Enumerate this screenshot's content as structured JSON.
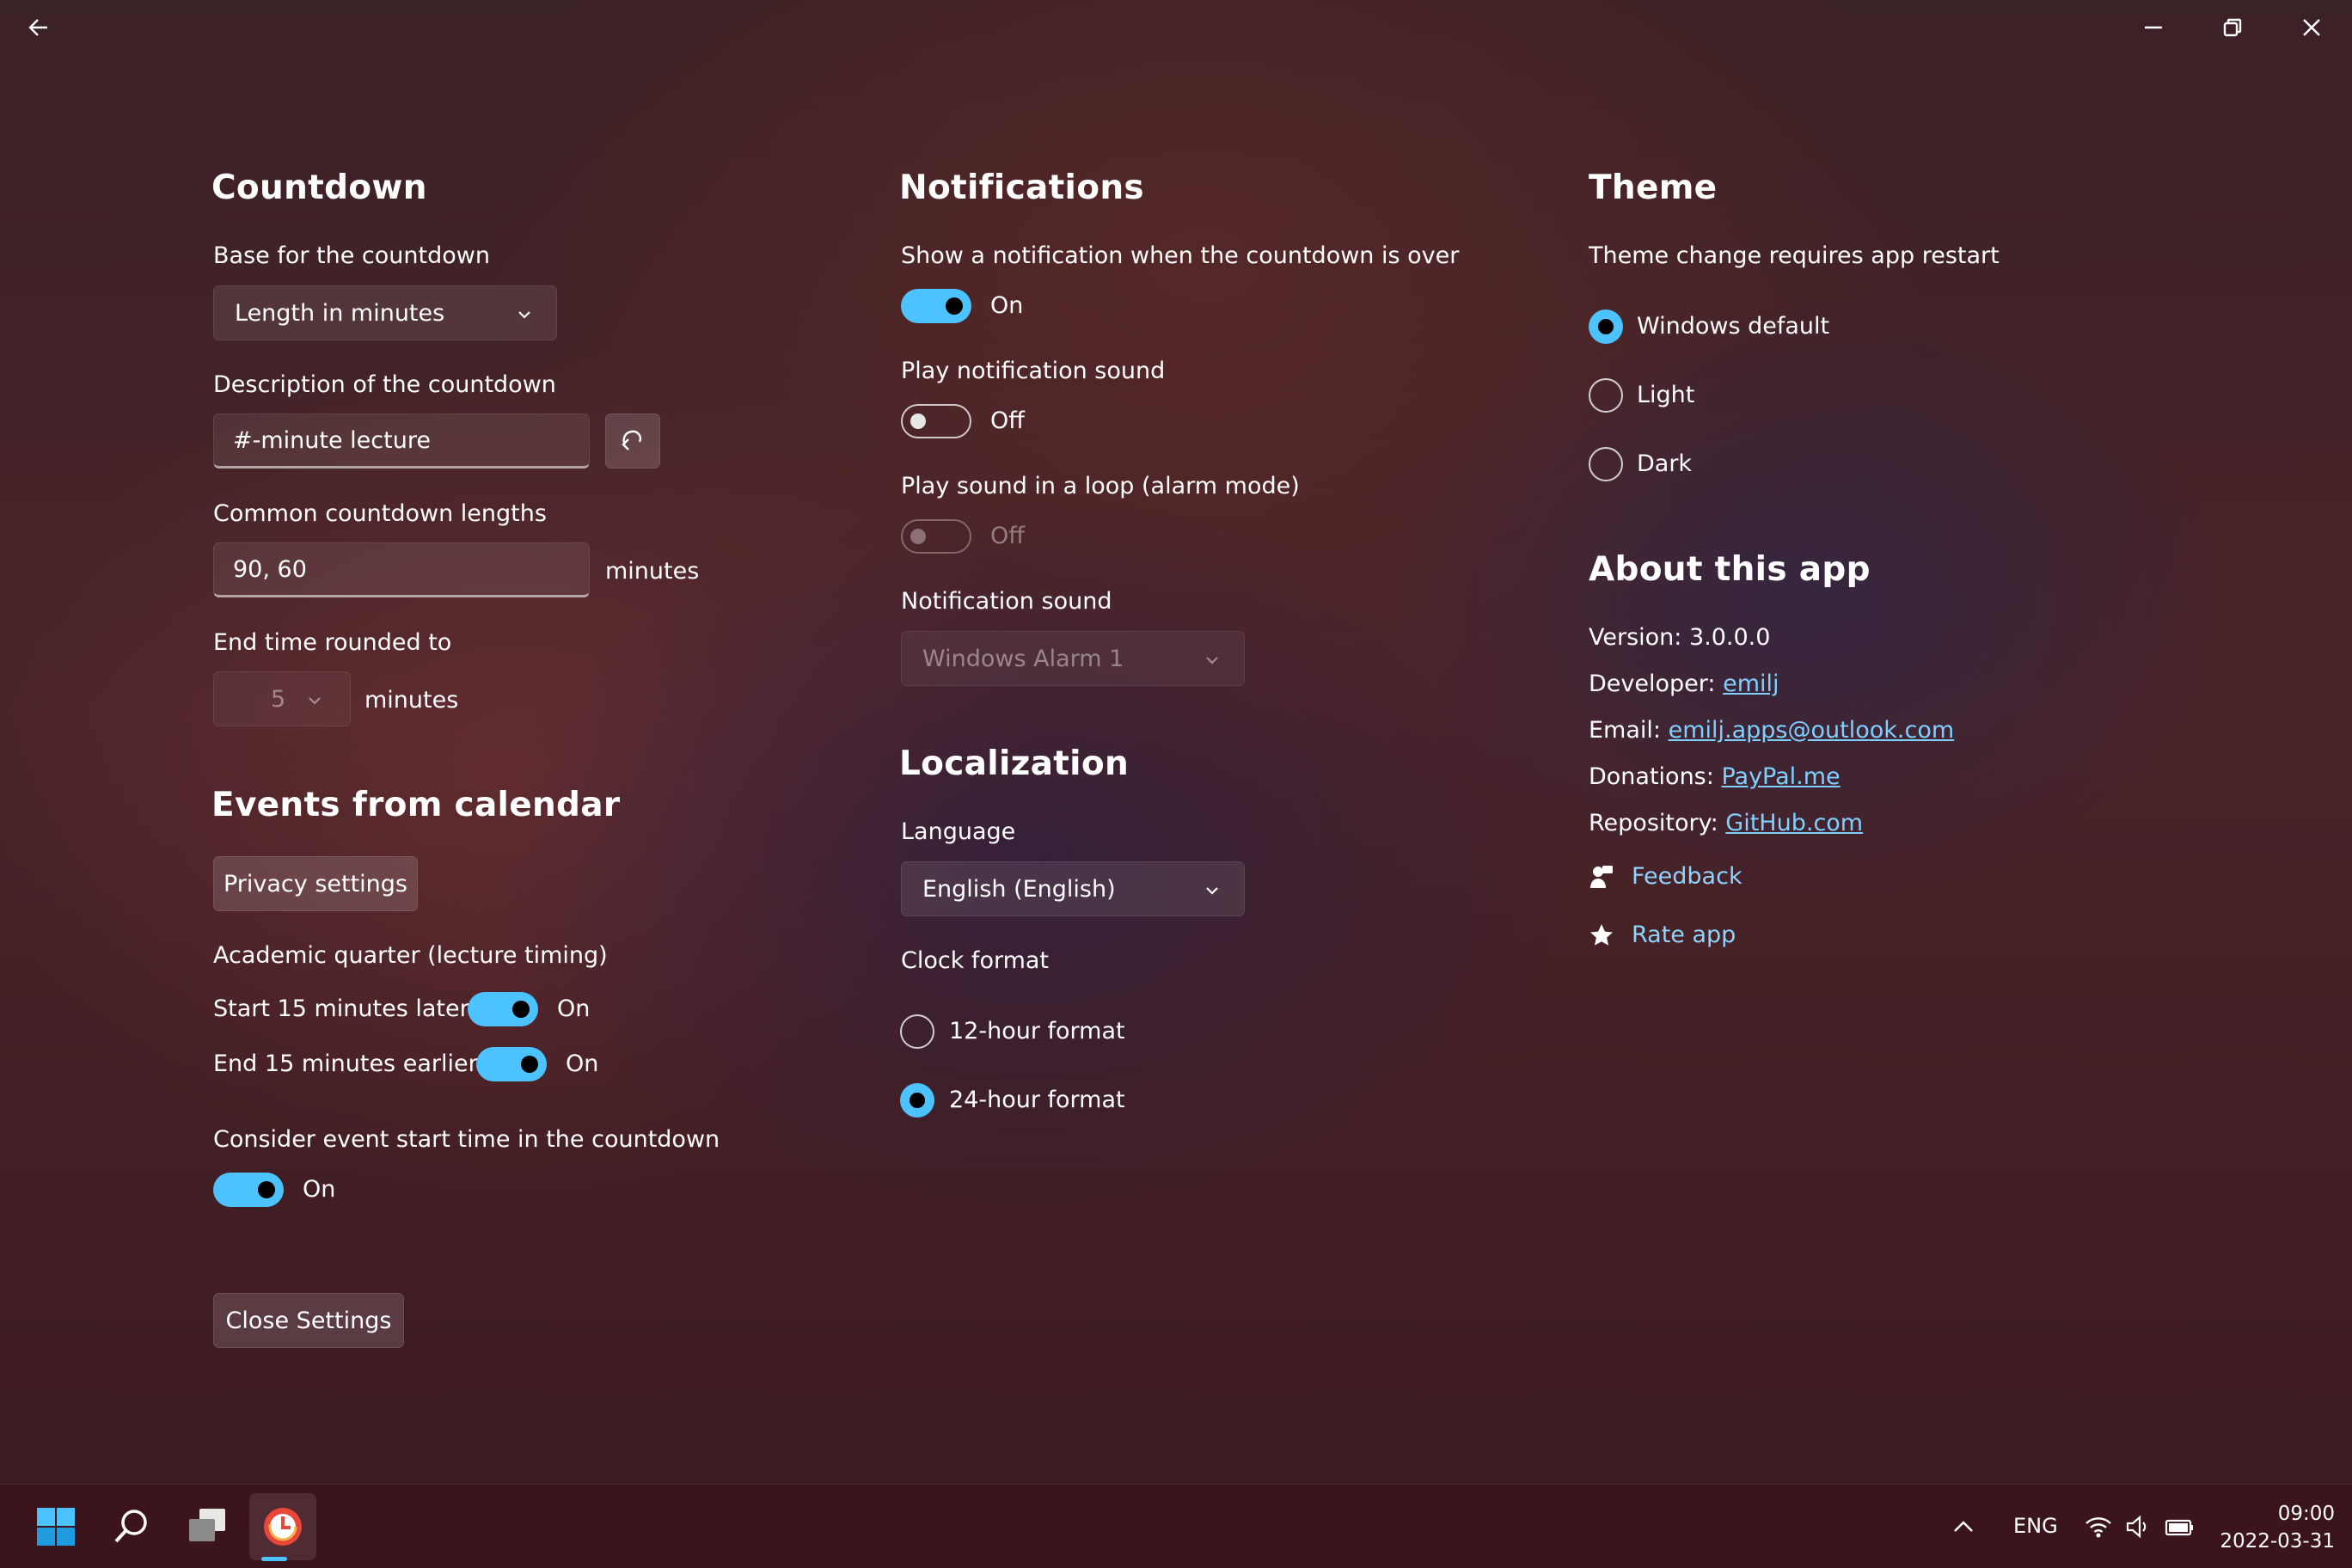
{
  "titlebar": {
    "back_icon": "arrow-left-icon",
    "minimize_icon": "minimize-icon",
    "restore_icon": "restore-icon",
    "close_icon": "close-icon"
  },
  "countdown": {
    "heading": "Countdown",
    "base_label": "Base for the countdown",
    "base_value": "Length in minutes",
    "description_label": "Description of the countdown",
    "description_value": "#-minute lecture",
    "common_label": "Common countdown lengths",
    "common_value": "90, 60",
    "common_unit": "minutes",
    "rounded_label": "End time rounded to",
    "rounded_value": "5",
    "rounded_unit": "minutes"
  },
  "events": {
    "heading": "Events from calendar",
    "privacy_button": "Privacy settings",
    "quarter_label": "Academic quarter (lecture timing)",
    "start_label": "Start 15 minutes later",
    "start_state": "On",
    "end_label": "End 15 minutes earlier",
    "end_state": "On",
    "consider_label": "Consider event start time in the countdown",
    "consider_state": "On",
    "close_button": "Close Settings"
  },
  "notifications": {
    "heading": "Notifications",
    "show_label": "Show a notification when the countdown is over",
    "show_state": "On",
    "sound_label": "Play notification sound",
    "sound_state": "Off",
    "loop_label": "Play sound in a loop (alarm mode)",
    "loop_state": "Off",
    "notif_sound_label": "Notification sound",
    "notif_sound_value": "Windows Alarm 1"
  },
  "localization": {
    "heading": "Localization",
    "language_label": "Language",
    "language_value": "English (English)",
    "clock_label": "Clock format",
    "clock_12": "12-hour format",
    "clock_24": "24-hour format",
    "selected_clock": "24-hour format"
  },
  "theme": {
    "heading": "Theme",
    "note": "Theme change requires app restart",
    "options": [
      "Windows default",
      "Light",
      "Dark"
    ],
    "selected": "Windows default"
  },
  "about": {
    "heading": "About this app",
    "version_label": "Version:",
    "version_value": "3.0.0.0",
    "developer_label": "Developer:",
    "developer_value": "emilj",
    "email_label": "Email:",
    "email_value": "emilj.apps@outlook.com",
    "donations_label": "Donations:",
    "donations_value": "PayPal.me",
    "repository_label": "Repository:",
    "repository_value": "GitHub.com",
    "feedback": "Feedback",
    "rate": "Rate app"
  },
  "taskbar": {
    "language": "ENG",
    "time": "09:00",
    "date": "2022-03-31"
  },
  "colors": {
    "accent": "#4cc2ff",
    "link": "#7fd0ff"
  }
}
